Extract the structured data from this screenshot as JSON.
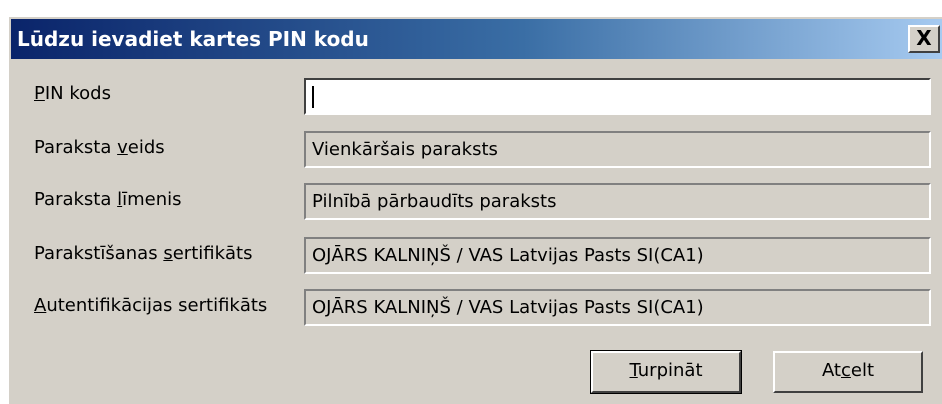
{
  "window": {
    "title": "Lūdzu ievadiet kartes PIN kodu",
    "close_glyph": "X"
  },
  "form": {
    "pin": {
      "label_mnemonic": "P",
      "label_rest": "IN kods",
      "value": ""
    },
    "signature_type": {
      "label_pre": "Paraksta ",
      "label_mnemonic": "v",
      "label_post": "eids",
      "value": "Vienkāršais paraksts"
    },
    "signature_level": {
      "label_pre": "Paraksta ",
      "label_mnemonic": "l",
      "label_post": "īmenis",
      "value": "Pilnībā pārbaudīts paraksts"
    },
    "signing_certificate": {
      "label_pre": "Parakstīšanas ",
      "label_mnemonic": "s",
      "label_post": "ertifikāts",
      "value": "OJĀRS KALNIŅŠ / VAS Latvijas Pasts SI(CA1)"
    },
    "auth_certificate": {
      "label_mnemonic": "A",
      "label_post": "utentifikācijas sertifikāts",
      "value": "OJĀRS KALNIŅŠ / VAS Latvijas Pasts SI(CA1)"
    }
  },
  "buttons": {
    "continue": {
      "mnemonic": "T",
      "rest": "urpināt"
    },
    "cancel": {
      "pre": "At",
      "mnemonic": "c",
      "post": "elt"
    }
  }
}
